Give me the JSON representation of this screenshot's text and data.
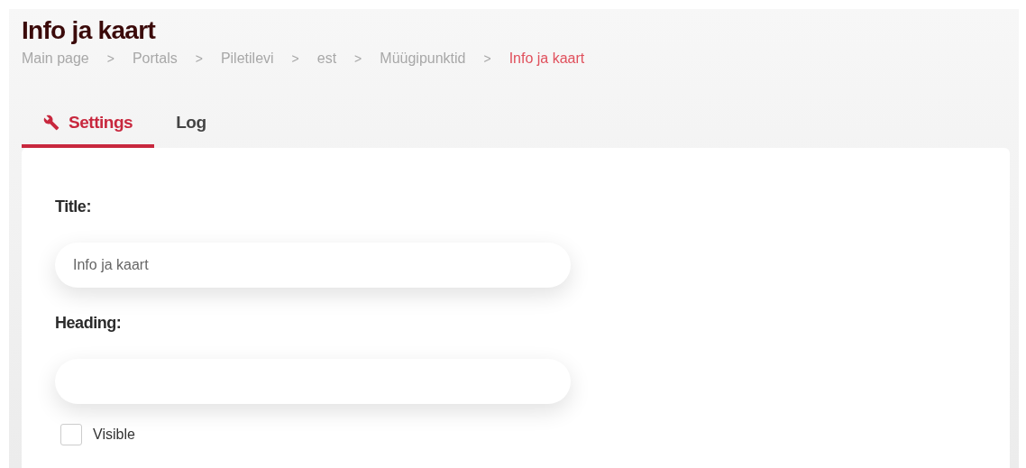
{
  "page_title": "Info ja kaart",
  "breadcrumbs": [
    {
      "kind": "link",
      "label": "Main page"
    },
    {
      "kind": "separator",
      "label": ">"
    },
    {
      "kind": "link",
      "label": "Portals"
    },
    {
      "kind": "separator",
      "label": ">"
    },
    {
      "kind": "link",
      "label": "Piletilevi"
    },
    {
      "kind": "separator",
      "label": ">"
    },
    {
      "kind": "link",
      "label": "est"
    },
    {
      "kind": "separator",
      "label": ">"
    },
    {
      "kind": "link",
      "label": "Müügipunktid"
    },
    {
      "kind": "separator",
      "label": ">"
    },
    {
      "kind": "current",
      "label": "Info ja kaart"
    }
  ],
  "tabs": [
    {
      "label": "Settings",
      "kind": "iconic",
      "selected": true
    },
    {
      "label": "Log",
      "kind": "plain",
      "selected": false
    }
  ],
  "form": {
    "fields": [
      {
        "label": "Title:",
        "value": "Info ja kaart"
      },
      {
        "label": "Heading:"
      }
    ],
    "checkboxes": [
      {
        "label": "Visible",
        "checked": false
      }
    ]
  }
}
